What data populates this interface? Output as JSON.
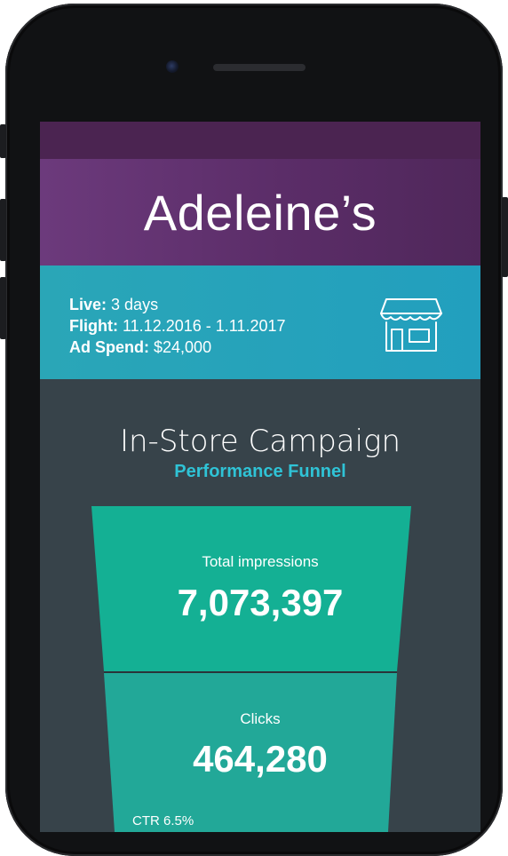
{
  "app": {
    "brand_title": "Adeleine’s"
  },
  "summary": {
    "live_label": "Live:",
    "live_value": "3 days",
    "flight_label": "Flight:",
    "flight_value": "11.12.2016 - 1.11.2017",
    "ad_spend_label": "Ad Spend:",
    "ad_spend_value": "$24,000",
    "icon": "store-icon"
  },
  "campaign": {
    "title": "In-Store Campaign",
    "subtitle": "Performance Funnel"
  },
  "funnel": {
    "stages": [
      {
        "label": "Total impressions",
        "value": "7,073,397",
        "color": "#14b094"
      },
      {
        "label": "Clicks",
        "value": "464,280",
        "color": "#22a898"
      }
    ],
    "ctr_text": "CTR 6.5%"
  },
  "colors": {
    "header_purple": "#6c3a7c",
    "info_teal": "#229fbe",
    "background": "#37434a",
    "accent_cyan": "#2fc3d6"
  }
}
